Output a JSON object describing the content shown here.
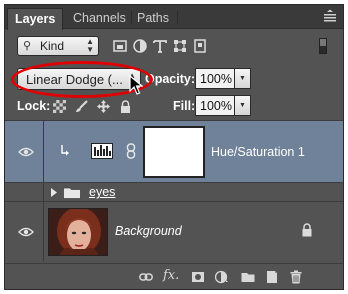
{
  "tabs": [
    {
      "label": "Layers",
      "active": true
    },
    {
      "label": "Channels",
      "active": false
    },
    {
      "label": "Paths",
      "active": false
    }
  ],
  "filter": {
    "kind_label": "Kind",
    "icons": [
      "pixel-filter-icon",
      "adjustment-filter-icon",
      "type-filter-icon",
      "shape-filter-icon",
      "smart-object-filter-icon"
    ]
  },
  "blend": {
    "mode": "Linear Dodge (...",
    "opacity_label": "Opacity:",
    "opacity_value": "100%",
    "fill_label": "Fill:",
    "fill_value": "100%",
    "lock_label": "Lock:"
  },
  "layers": [
    {
      "name": "Hue/Saturation 1",
      "type": "adjustment",
      "selected": true
    },
    {
      "name": "eyes",
      "type": "group",
      "selected": false
    },
    {
      "name": "Background",
      "type": "image",
      "selected": false,
      "locked": true
    }
  ],
  "colors": {
    "panel_bg": "#535353",
    "selected_row": "#6f8299",
    "highlight": "#e00000"
  }
}
